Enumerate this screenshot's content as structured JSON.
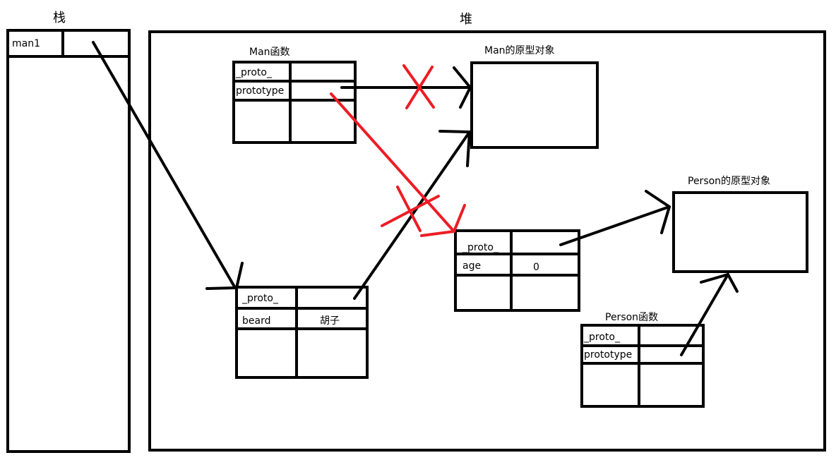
{
  "stack": {
    "title": "栈",
    "var_name": "man1"
  },
  "heap": {
    "title": "堆"
  },
  "man_function": {
    "label": "Man函数",
    "rows": [
      "_proto_",
      "prototype"
    ]
  },
  "man_prototype": {
    "label": "Man的原型对象"
  },
  "person_prototype": {
    "label": "Person的原型对象"
  },
  "person_instance": {
    "rows": [
      {
        "key": "_proto_",
        "value": ""
      },
      {
        "key": "age",
        "value": "0"
      }
    ]
  },
  "man_instance": {
    "rows": [
      {
        "key": "_proto_",
        "value": ""
      },
      {
        "key": "beard",
        "value": "胡子"
      }
    ]
  },
  "person_function": {
    "label": "Person函数",
    "rows": [
      "_proto_",
      "prototype"
    ]
  },
  "colors": {
    "stroke": "#000000",
    "crossed_out": "#ed1c24"
  }
}
